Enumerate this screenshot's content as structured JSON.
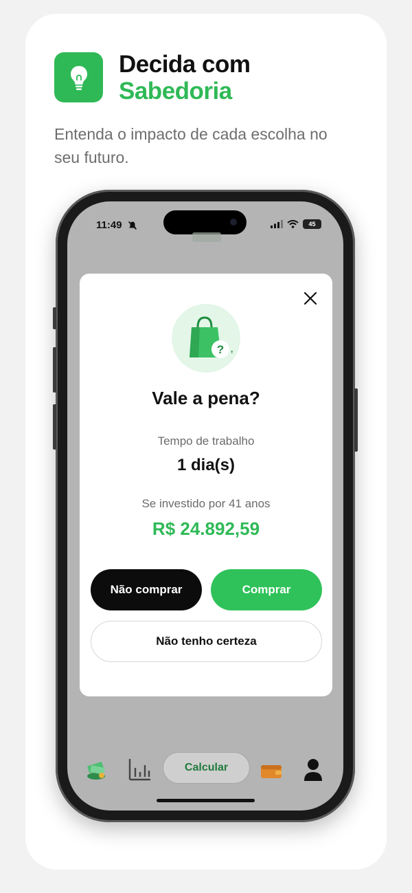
{
  "header": {
    "title_line1": "Decida com",
    "title_line2": "Sabedoria",
    "subtitle": "Entenda o impacto de cada escolha no seu futuro."
  },
  "status_bar": {
    "time": "11:49",
    "battery": "45"
  },
  "modal": {
    "title": "Vale a pena?",
    "work_time_label": "Tempo de trabalho",
    "work_time_value": "1 dia(s)",
    "investment_label": "Se investido por 41 anos",
    "investment_value": "R$ 24.892,59",
    "button_dont_buy": "Não comprar",
    "button_buy": "Comprar",
    "button_unsure": "Não tenho certeza"
  },
  "bottom_nav": {
    "calculate_label": "Calcular"
  },
  "colors": {
    "brand_green": "#2fb956",
    "dark_button": "#0c0c0c"
  }
}
